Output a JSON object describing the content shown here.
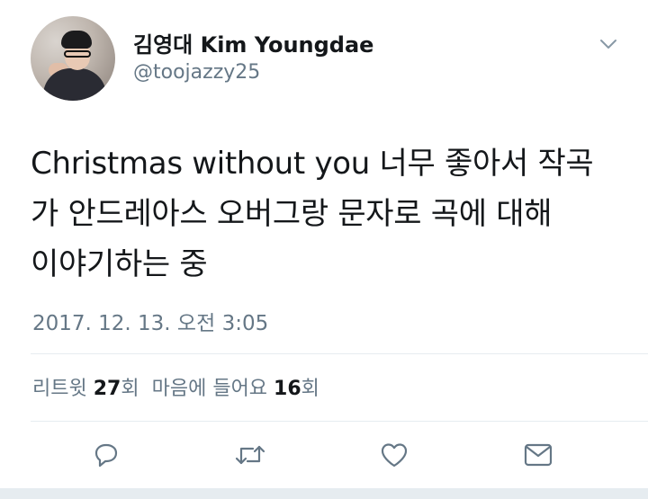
{
  "user": {
    "display_name": "김영대 Kim Youngdae",
    "handle": "@toojazzy25"
  },
  "tweet": {
    "text": "Christmas without you 너무 좋아서 작곡\n가 안드레아스 오버그랑 문자로 곡에 대해\n이야기하는 중",
    "timestamp": "2017. 12. 13. 오전 3:05"
  },
  "stats": {
    "retweets_label": "리트윗",
    "retweets_count": "27",
    "retweets_unit": "회",
    "likes_label": "마음에 들어요",
    "likes_count": "16",
    "likes_unit": "회"
  },
  "actions": [
    "reply-icon",
    "retweet-icon",
    "like-icon",
    "message-icon"
  ],
  "colors": {
    "text": "#14171a",
    "secondary": "#657786",
    "divider": "#e6ecf0",
    "icon": "#657786"
  }
}
